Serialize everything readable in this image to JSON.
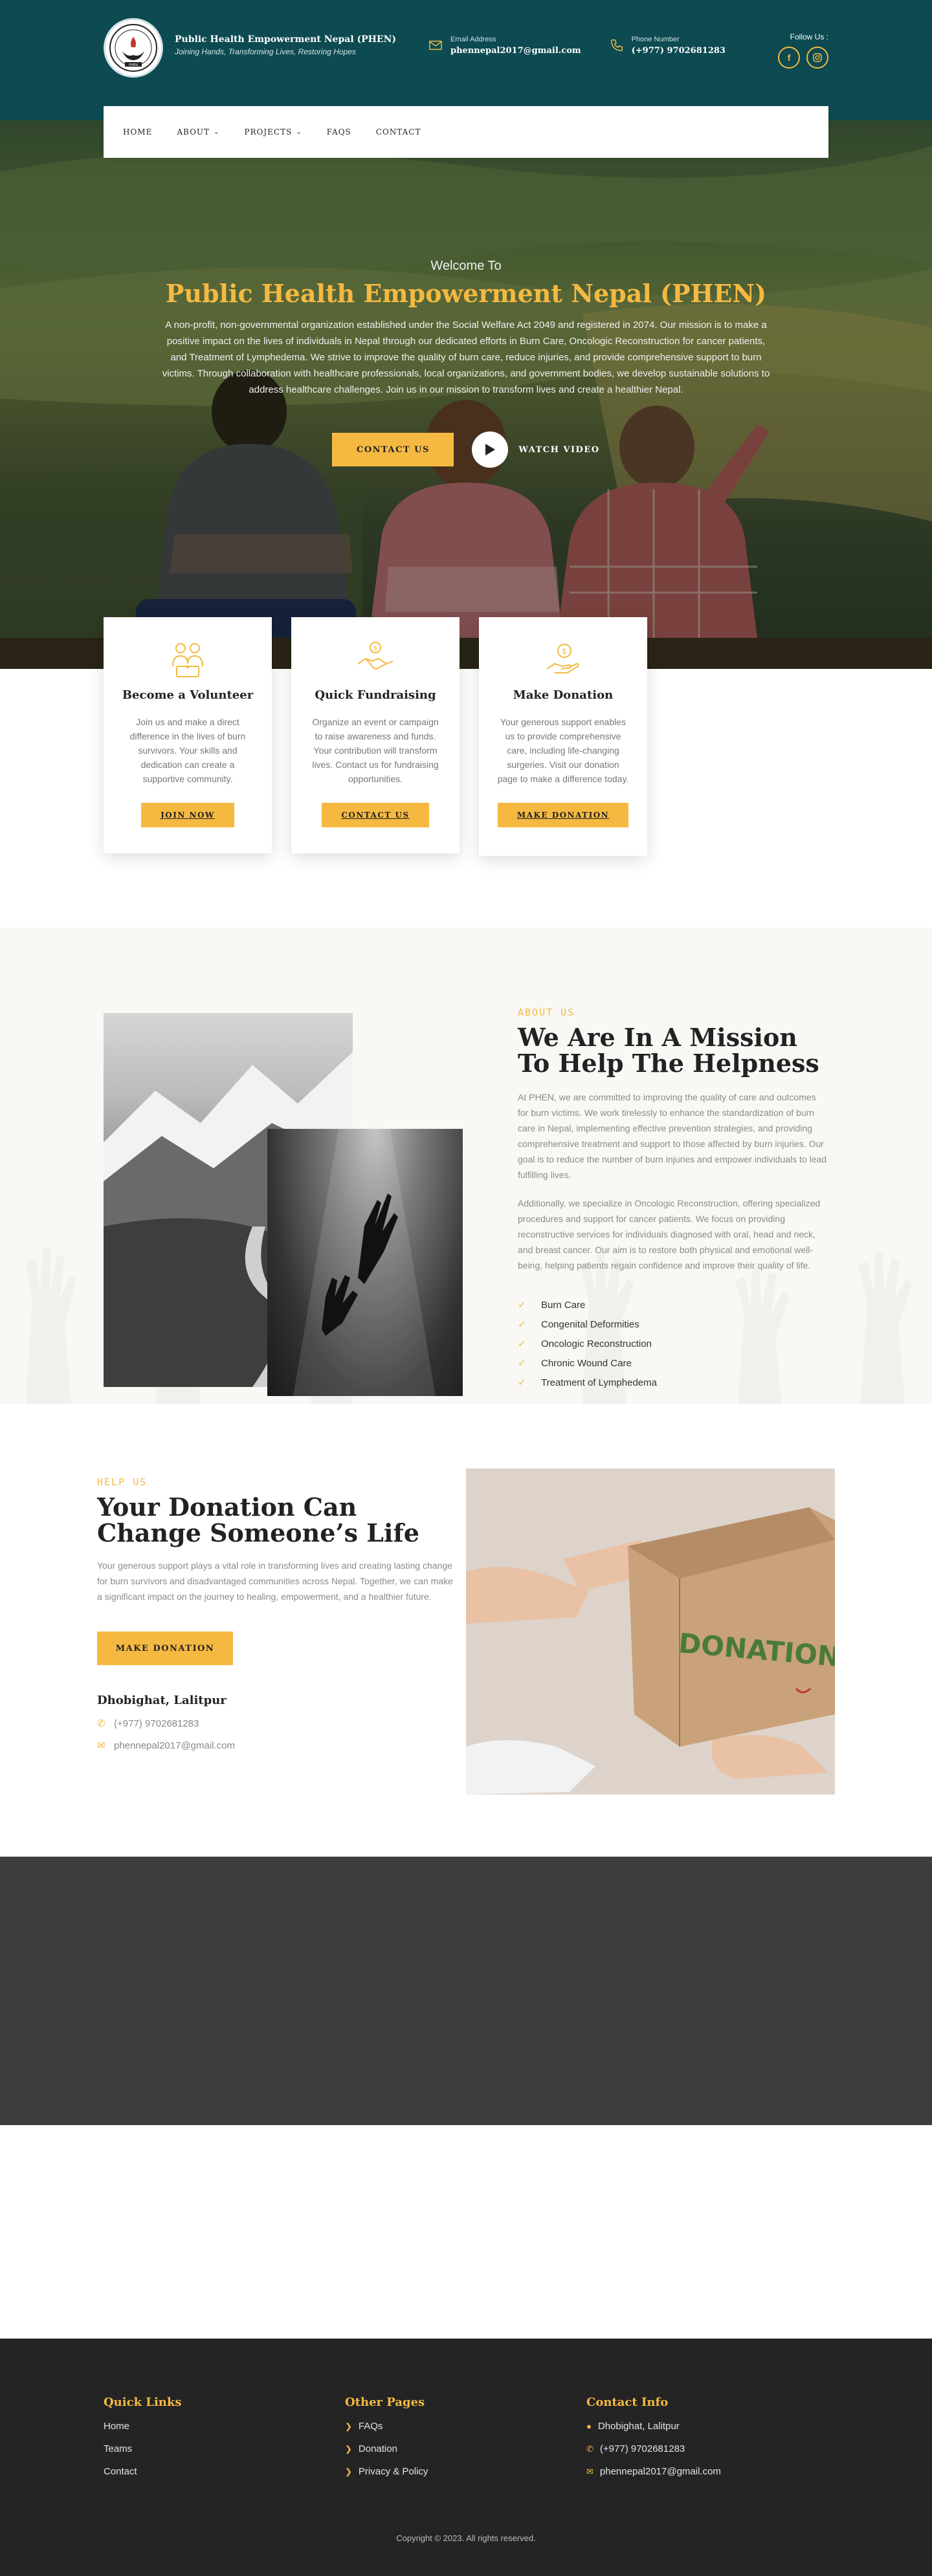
{
  "header": {
    "org_name": "Public Health Empowerment Nepal (PHEN)",
    "tagline": "Joining Hands, Transforming Lives, Restoring Hopes",
    "email_label": "Email Address",
    "email": "phennepal2017@gmail.com",
    "phone_label": "Phone Number",
    "phone": "(+977) 9702681283",
    "follow_label": "Follow Us :",
    "socials": [
      "facebook-icon",
      "instagram-icon"
    ],
    "logo_text": "PHEN",
    "color_primary": "#0d4a52",
    "color_accent": "#f5b942"
  },
  "nav": {
    "items": [
      "HOME",
      "ABOUT",
      "PROJECTS",
      "FAQS",
      "CONTACT"
    ]
  },
  "hero": {
    "welcome": "Welcome To",
    "title": "Public Health Empowerment Nepal (PHEN)",
    "description": "A non-profit, non-governmental organization established under the Social Welfare Act 2049 and registered in 2074. Our mission is to make a positive impact on the lives of individuals in Nepal through our dedicated efforts in Burn Care, Oncologic Reconstruction for cancer patients, and Treatment of Lymphedema. We strive to improve the quality of burn care, reduce injuries, and provide comprehensive support to burn victims. Through collaboration with healthcare professionals, local organizations, and government bodies, we develop sustainable solutions to address healthcare challenges. Join us in our mission to transform lives and create a healthier Nepal.",
    "cta": "CONTACT US",
    "video": "WATCH VIDEO"
  },
  "cards": [
    {
      "title": "Become a Volunteer",
      "text": "Join us and make a direct difference in the lives of burn survivors. Your skills and dedication can create a supportive community.",
      "button": "JOIN NOW",
      "icon": "volunteer-icon"
    },
    {
      "title": "Quick Fundraising",
      "text": "Organize an event or campaign to raise awareness and funds. Your contribution will transform lives. Contact us for fundraising opportunities.",
      "button": "CONTACT US",
      "icon": "handshake-icon"
    },
    {
      "title": "Make Donation",
      "text": "Your generous support enables us to provide comprehensive care, including life-changing surgeries. Visit our donation page to make a difference today.",
      "button": "MAKE DONATION",
      "icon": "donation-hand-icon"
    }
  ],
  "about": {
    "kicker": "ABOUT US",
    "title": "We Are In A Mission To Help The Helpness",
    "para1": "At PHEN, we are committed to improving the quality of care and outcomes for burn victims. We work tirelessly to enhance the standardization of burn care in Nepal, implementing effective prevention strategies, and providing comprehensive treatment and support to those affected by burn injuries. Our goal is to reduce the number of burn injuries and empower individuals to lead fulfilling lives.",
    "para2": "Additionally, we specialize in Oncologic Reconstruction, offering specialized procedures and support for cancer patients. We focus on providing reconstructive services for individuals diagnosed with oral, head and neck, and breast cancer. Our aim is to restore both physical and emotional well-being, helping patients regain confidence and improve their quality of life.",
    "list": [
      "Burn Care",
      "Congenital Deformities",
      "Oncologic Reconstruction",
      "Chronic Wound Care",
      "Treatment of Lymphedema"
    ]
  },
  "help": {
    "kicker": "HELP US",
    "title": "Your Donation Can Change Someone’s Life",
    "para": " Your generous support plays a vital role in transforming lives and creating lasting change for burn survivors and disadvantaged communities across Nepal. Together, we can make a significant impact on the journey to healing, empowerment, and a healthier future.",
    "button": "MAKE DONATION",
    "location": "Dhobighat, Lalitpur",
    "phone": "(+977) 9702681283",
    "email": "phennepal2017@gmail.com",
    "box_text": "DONATION"
  },
  "footer": {
    "quick_links_title": "Quick Links",
    "quick_links": [
      "Home",
      "Teams",
      "Contact"
    ],
    "other_pages_title": "Other Pages",
    "other_pages": [
      "FAQs",
      "Donation",
      "Privacy & Policy"
    ],
    "contact_title": "Contact Info",
    "contact_location": "Dhobighat, Lalitpur",
    "contact_phone": "(+977) 9702681283",
    "contact_email": "phennepal2017@gmail.com",
    "copyright": "Copyright © 2023. All rights reserved."
  }
}
